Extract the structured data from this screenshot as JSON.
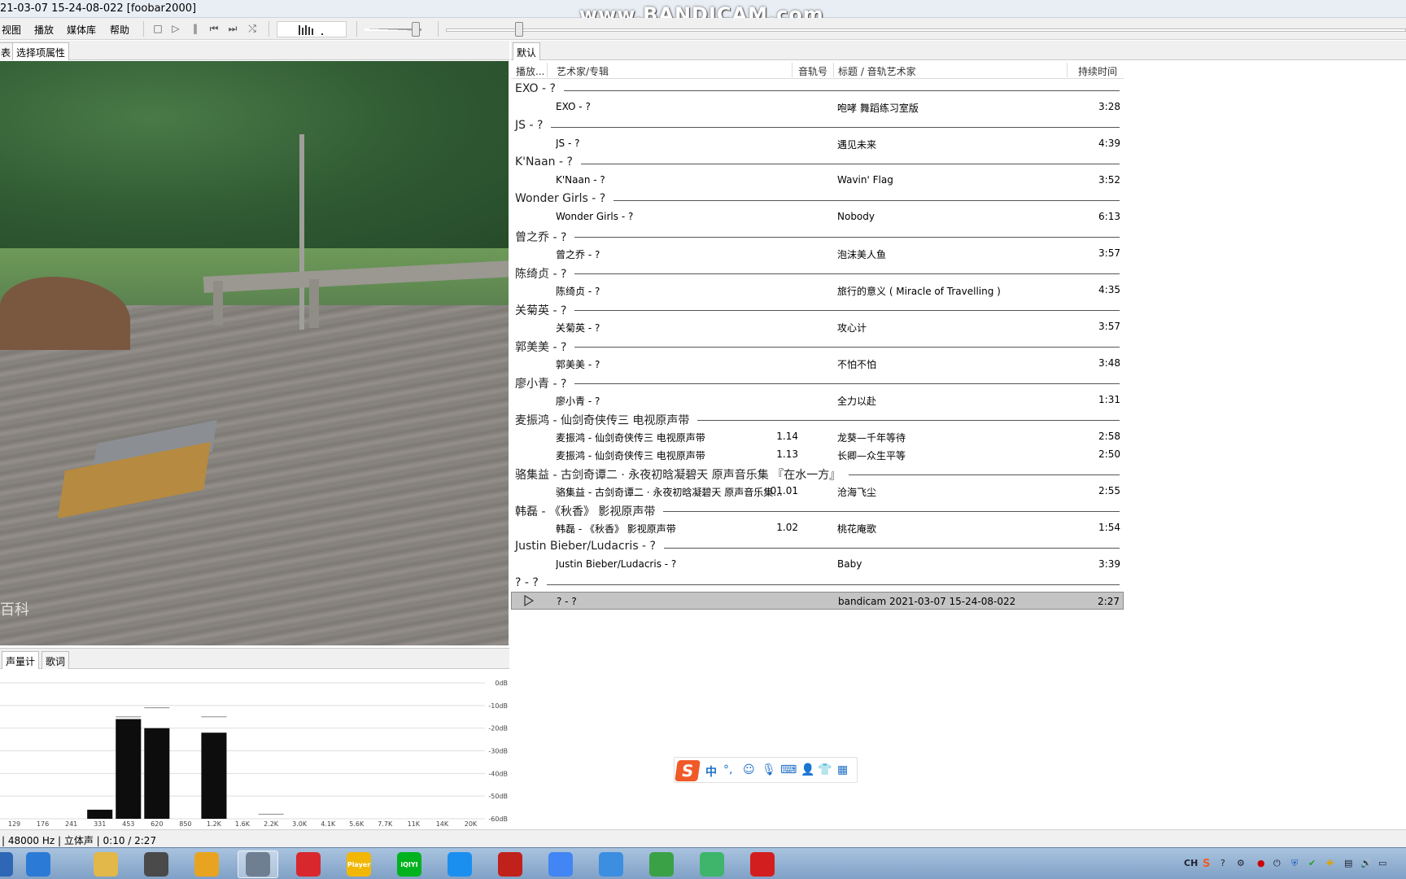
{
  "window": {
    "title": "21-03-07 15-24-08-022  [foobar2000]",
    "watermark": "www.BANDICAM.com"
  },
  "menu": [
    "视图",
    "播放",
    "媒体库",
    "帮助"
  ],
  "left_tabs": [
    "表",
    "选择项属性"
  ],
  "vis_tabs": [
    "声量计",
    "歌词"
  ],
  "art_logo": "百科",
  "spectrum": {
    "db_labels": [
      "0dB",
      "-10dB",
      "-20dB",
      "-30dB",
      "-40dB",
      "-50dB",
      "-60dB"
    ],
    "freq_labels": [
      "129",
      "176",
      "241",
      "331",
      "453",
      "620",
      "850",
      "1.2K",
      "1.6K",
      "2.2K",
      "3.0K",
      "4.1K",
      "5.6K",
      "7.7K",
      "11K",
      "14K",
      "20K"
    ],
    "levels_db": [
      -60,
      -60,
      -60,
      -56,
      -16,
      -20,
      -60,
      -22,
      -60,
      -60,
      -60,
      -60,
      -60,
      -60,
      -60,
      -60,
      -60
    ],
    "peaks_db": [
      null,
      null,
      null,
      null,
      -15,
      -11,
      null,
      -15,
      null,
      -58,
      null,
      null,
      null,
      null,
      null,
      null,
      null
    ]
  },
  "playlist_tab": "默认",
  "columns": {
    "playing": "播放...",
    "artist_album": "艺术家/专辑",
    "track_no": "音轨号",
    "title_artist": "标题 / 音轨艺术家",
    "duration": "持续时间"
  },
  "groups": [
    {
      "header": "EXO - ?",
      "tracks": [
        {
          "artist": "EXO - ?",
          "num": "",
          "title": "咆哮 舞蹈练习室版",
          "dur": "3:28"
        }
      ]
    },
    {
      "header": "JS - ?",
      "tracks": [
        {
          "artist": "JS - ?",
          "num": "",
          "title": "遇见未来",
          "dur": "4:39"
        }
      ]
    },
    {
      "header": "K'Naan - ?",
      "tracks": [
        {
          "artist": "K'Naan - ?",
          "num": "",
          "title": "Wavin' Flag",
          "dur": "3:52"
        }
      ]
    },
    {
      "header": "Wonder Girls - ?",
      "tracks": [
        {
          "artist": "Wonder Girls - ?",
          "num": "",
          "title": "Nobody",
          "dur": "6:13"
        }
      ]
    },
    {
      "header": "曾之乔 - ?",
      "tracks": [
        {
          "artist": "曾之乔 - ?",
          "num": "",
          "title": "泡沫美人鱼",
          "dur": "3:57"
        }
      ]
    },
    {
      "header": "陈绮贞 - ?",
      "tracks": [
        {
          "artist": "陈绮贞 - ?",
          "num": "",
          "title": "旅行的意义 ( Miracle of Travelling )",
          "dur": "4:35"
        }
      ]
    },
    {
      "header": "关菊英 - ?",
      "tracks": [
        {
          "artist": "关菊英 - ?",
          "num": "",
          "title": "攻心计",
          "dur": "3:57"
        }
      ]
    },
    {
      "header": "郭美美 - ?",
      "tracks": [
        {
          "artist": "郭美美 - ?",
          "num": "",
          "title": "不怕不怕",
          "dur": "3:48"
        }
      ]
    },
    {
      "header": "廖小青 - ?",
      "tracks": [
        {
          "artist": "廖小青 - ?",
          "num": "",
          "title": "全力以赴",
          "dur": "1:31"
        }
      ]
    },
    {
      "header": "麦振鸿 - 仙剑奇侠传三 电视原声带",
      "tracks": [
        {
          "artist": "麦振鸿 - 仙剑奇侠传三 电视原声带",
          "num": "1.14",
          "title": "龙葵—千年等待",
          "dur": "2:58"
        },
        {
          "artist": "麦振鸿 - 仙剑奇侠传三 电视原声带",
          "num": "1.13",
          "title": "长卿—众生平等",
          "dur": "2:50"
        }
      ]
    },
    {
      "header": "骆集益 - 古剑奇谭二 · 永夜初晗凝碧天 原声音乐集 『在水一方』",
      "tracks": [
        {
          "artist": "骆集益 - 古剑奇谭二 · 永夜初晗凝碧天 原声音乐集...",
          "num": "01.01",
          "title": "沧海飞尘",
          "dur": "2:55"
        }
      ]
    },
    {
      "header": "韩磊 - 《秋香》 影视原声带",
      "tracks": [
        {
          "artist": "韩磊 - 《秋香》 影视原声带",
          "num": "1.02",
          "title": "桃花庵歌",
          "dur": "1:54"
        }
      ]
    },
    {
      "header": "Justin Bieber/Ludacris - ?",
      "tracks": [
        {
          "artist": "Justin Bieber/Ludacris - ?",
          "num": "",
          "title": "Baby",
          "dur": "3:39"
        }
      ]
    },
    {
      "header": "? - ?",
      "tracks": [
        {
          "artist": "? - ?",
          "num": "",
          "title": "bandicam 2021-03-07 15-24-08-022",
          "dur": "2:27",
          "playing": true
        }
      ]
    }
  ],
  "ime": {
    "lang": "中",
    "punct": "°,"
  },
  "status": "| 48000 Hz | 立体声 | 0:10 / 2:27",
  "taskbar": {
    "tray_lang": "CH",
    "apps": [
      {
        "name": "search",
        "color": "#2b7bd6"
      },
      {
        "name": "folder",
        "color": "#e2b84a"
      },
      {
        "name": "video-editor",
        "color": "#4a4a4a"
      },
      {
        "name": "headphones",
        "color": "#e8a321"
      },
      {
        "name": "foobar2000",
        "color": "#6f7f91",
        "active": true
      },
      {
        "name": "netease-music",
        "color": "#d9272e"
      },
      {
        "name": "player",
        "color": "#f2b705",
        "label": "Player"
      },
      {
        "name": "iqiyi",
        "color": "#00b21e",
        "label": "iQIYI"
      },
      {
        "name": "youku",
        "color": "#1b8ff0"
      },
      {
        "name": "flash",
        "color": "#c1211b"
      },
      {
        "name": "chrome",
        "color": "#4285f4"
      },
      {
        "name": "feishu",
        "color": "#3b8ee0"
      },
      {
        "name": "sync",
        "color": "#3aa146"
      },
      {
        "name": "video-player",
        "color": "#3fb56b"
      },
      {
        "name": "recorder",
        "color": "#d21e1e"
      }
    ]
  },
  "colors": {
    "accent": "#f05a28",
    "playing_row": "#c4c4c4"
  }
}
